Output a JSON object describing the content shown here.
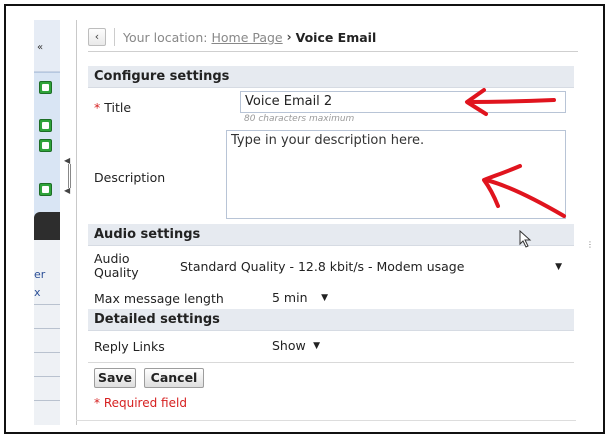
{
  "breadcrumb": {
    "back_label": "‹",
    "prefix": "Your location:",
    "home_link": "Home Page",
    "separator": "›",
    "current": "Voice Email"
  },
  "sidebar": {
    "links": [
      "er",
      "x"
    ]
  },
  "configure": {
    "heading": "Configure settings",
    "title_required_mark": "*",
    "title_label": "Title",
    "title_value": "Voice Email 2",
    "title_hint": "80 characters maximum",
    "description_label": "Description",
    "description_placeholder": "Type in your description here."
  },
  "audio": {
    "heading": "Audio settings",
    "quality_label": "Audio Quality",
    "quality_value": "Standard Quality - 12.8 kbit/s - Modem usage",
    "max_length_label": "Max message length",
    "max_length_value": "5 min"
  },
  "detailed": {
    "heading": "Detailed settings",
    "reply_links_label": "Reply Links",
    "reply_links_value": "Show"
  },
  "actions": {
    "save_label": "Save",
    "cancel_label": "Cancel",
    "required_note": "* Required field"
  },
  "colors": {
    "annotation_red": "#e0141e",
    "required_red": "#d62020",
    "section_bg": "#e6eaf0"
  },
  "icons": {
    "collapse": "double-chevron-icon",
    "plus": "green-plus-icon",
    "cursor": "mouse-pointer-icon"
  }
}
